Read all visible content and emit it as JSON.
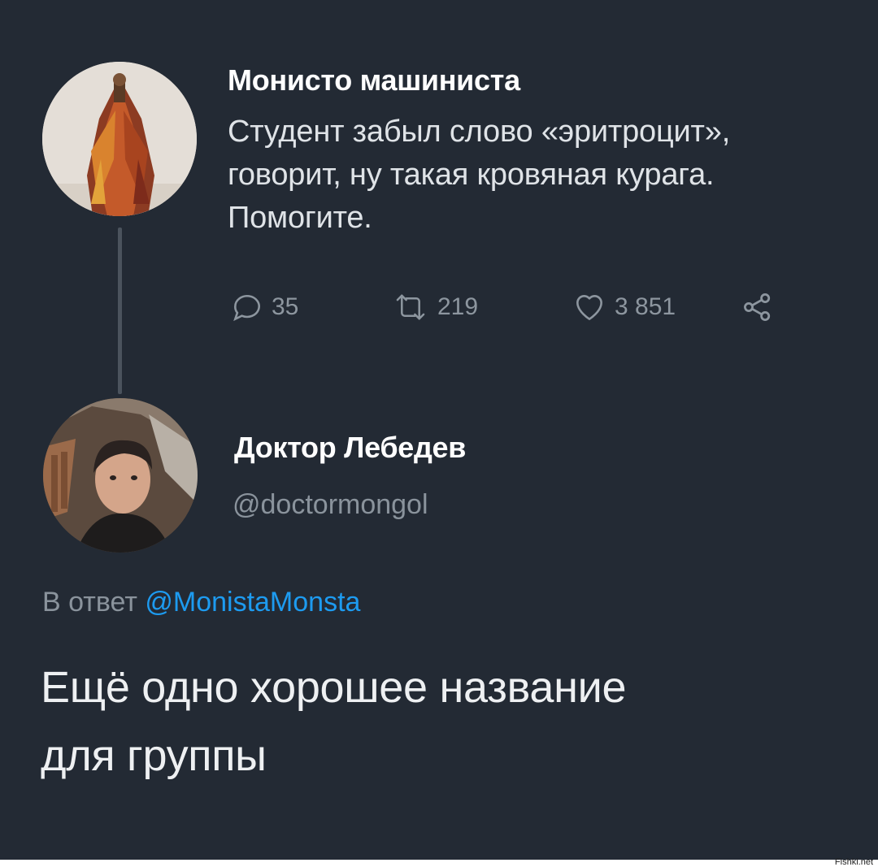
{
  "tweet": {
    "author_name": "Монисто машиниста",
    "text_lines": [
      "Студент забыл слово «эритроцит»,",
      "говорит, ну такая кровяная курага.",
      "Помогите."
    ],
    "replies_count": "35",
    "retweets_count": "219",
    "likes_count": "3 851",
    "icons": {
      "reply": "reply-icon",
      "retweet": "retweet-icon",
      "like": "heart-icon",
      "share": "share-icon"
    }
  },
  "reply": {
    "author_name": "Доктор Лебедев",
    "handle": "@doctormongol",
    "in_reply_prefix": "В ответ",
    "in_reply_mention": "@MonistaMonsta",
    "text_lines": [
      "Ещё одно хорошее название",
      "для группы"
    ]
  },
  "watermark": "Fishki.net",
  "colors": {
    "background": "#232a34",
    "mention": "#1d9bf0",
    "muted": "#8a939c"
  }
}
